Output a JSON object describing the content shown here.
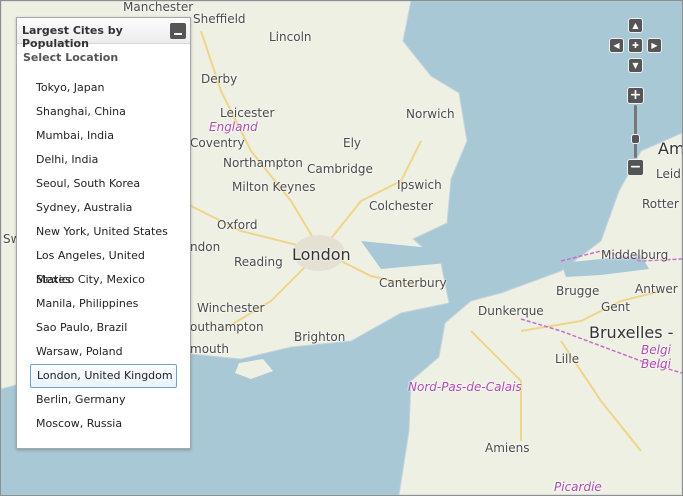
{
  "panel": {
    "title": "Largest Cites by Population",
    "subtitle": "Select Location",
    "selected": "London, United Kingdom",
    "items": [
      "Tokyo, Japan",
      "Shanghai, China",
      "Mumbai, India",
      "Delhi, India",
      "Seoul, South Korea",
      "Sydney, Australia",
      "New York, United States",
      "Los Angeles, United States",
      "Mexico City, Mexico",
      "Manila, Philippines",
      "Sao Paulo, Brazil",
      "Warsaw, Poland",
      "London, United Kingdom",
      "Berlin, Germany",
      "Moscow, Russia"
    ]
  },
  "map": {
    "labels": {
      "manchester": "Manchester",
      "sheffield": "Sheffield",
      "lincoln": "Lincoln",
      "derby": "Derby",
      "leicester": "Leicester",
      "england": "England",
      "coventry": "Coventry",
      "norwich": "Norwich",
      "ely": "Ely",
      "northampton": "Northampton",
      "cambridge": "Cambridge",
      "milton_keynes": "Milton Keynes",
      "ipswich": "Ipswich",
      "colchester": "Colchester",
      "oxford": "Oxford",
      "london": "London",
      "reading": "Reading",
      "ndon": "ndon",
      "canterbury": "Canterbury",
      "winchester": "Winchester",
      "outhampton": "outhampton",
      "brighton": "Brighton",
      "mouth": "mouth",
      "sw": "Sw",
      "middelburg": "Middelburg",
      "brugge": "Brugge",
      "gent": "Gent",
      "antwerp": "Antwer",
      "dunkerque": "Dunkerque",
      "bruxelles": "Bruxelles -",
      "lille": "Lille",
      "belgi1": "Belgi",
      "belgi2": "Belgi",
      "nord": "Nord-Pas-de-Calais",
      "amiens": "Amiens",
      "picardie": "Picardie",
      "leid": "Leid",
      "rotter": "Rotter",
      "am": "Am"
    }
  },
  "icons": {
    "nav_up": "▲",
    "nav_down": "▼",
    "nav_left": "◀",
    "nav_right": "▶",
    "nav_center": "✚",
    "zoom_in": "+",
    "zoom_out": "−"
  },
  "colors": {
    "sea": "#a8c8d6",
    "land": "#eef0e4",
    "selection_border": "#6aa2d4",
    "region_label": "#b04cb0",
    "control": "#555555"
  }
}
